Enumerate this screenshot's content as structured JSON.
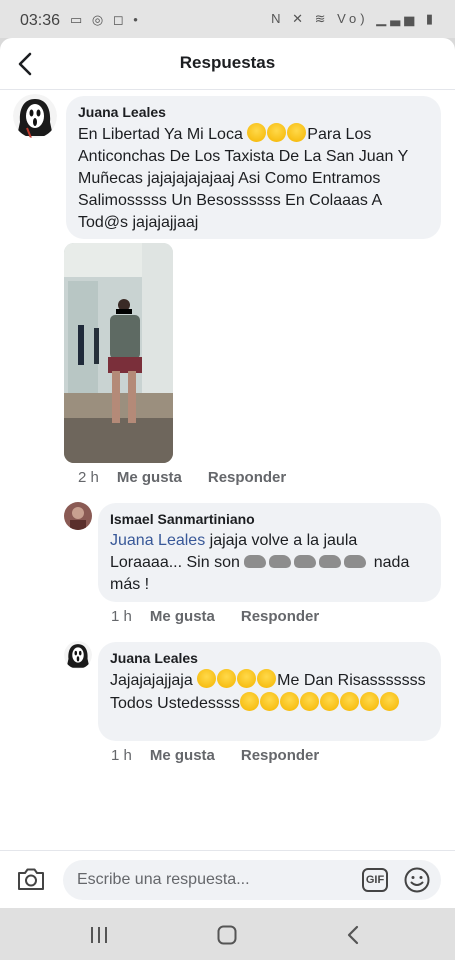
{
  "status_bar": {
    "time": "03:36",
    "left_icons": [
      "gallery-icon",
      "whatsapp-icon",
      "instagram-icon",
      "dot-icon"
    ],
    "right_icons": [
      "nfc-icon",
      "mute-icon",
      "wifi-icon",
      "volte-icon",
      "signal-icon",
      "battery-icon"
    ],
    "left_glyphs": "▭ ◎ ◻ •",
    "right_glyphs": "N ✕ ≋ Vo) ▁▃▅ ▮"
  },
  "header": {
    "title": "Respuestas",
    "back_icon": "chevron-left-icon"
  },
  "comments": [
    {
      "author": "Juana Leales",
      "text_parts": [
        "En Libertad Ya Mi Loca ",
        "Para Los Anticonchas De Los Taxista De La San Juan Y Muñecas jajajajajajaaj Asi Como Entramos Salimosssss  Un Besossssss En  Colaaas A Tod@s jajajajjaaj"
      ],
      "emojis": [
        "sunglasses-emoji",
        "sweat-smile-emoji",
        "blowing-kiss-emoji"
      ],
      "has_photo": true,
      "time": "2 h",
      "like_label": "Me gusta",
      "reply_label": "Responder"
    },
    {
      "author": "Ismael Sanmartiniano",
      "mention": "Juana Leales",
      "text_before_rats": " jajaja volve a la jaula Loraaaa... Sin son ",
      "emojis": [
        "rat-emoji",
        "rat-emoji",
        "rat-emoji",
        "rat-emoji",
        "rat-emoji"
      ],
      "text_after_rats": " nada más !",
      "time": "1 h",
      "like_label": "Me gusta",
      "reply_label": "Responder"
    },
    {
      "author": "Juana Leales",
      "text_start": "Jajajajajjaja ",
      "emojis_start": [
        "rofl-emoji",
        "rofl-emoji",
        "rofl-emoji",
        "rofl-emoji"
      ],
      "text_middle": "Me Dan Risasssssss Todos Ustedessss",
      "emojis_middle": [
        "rofl-emoji",
        "rofl-emoji",
        "rofl-emoji"
      ],
      "emojis_end": [
        "rofl-emoji",
        "rofl-emoji",
        "rofl-emoji",
        "rofl-emoji",
        "rofl-emoji"
      ],
      "time": "1 h",
      "like_label": "Me gusta",
      "reply_label": "Responder"
    }
  ],
  "composer": {
    "placeholder": "Escribe una respuesta...",
    "camera_icon": "camera-icon",
    "gif_label": "GIF",
    "emoji_icon": "smiley-icon"
  },
  "nav_bar": {
    "buttons": [
      "recent-apps-icon",
      "home-icon",
      "back-icon"
    ]
  }
}
